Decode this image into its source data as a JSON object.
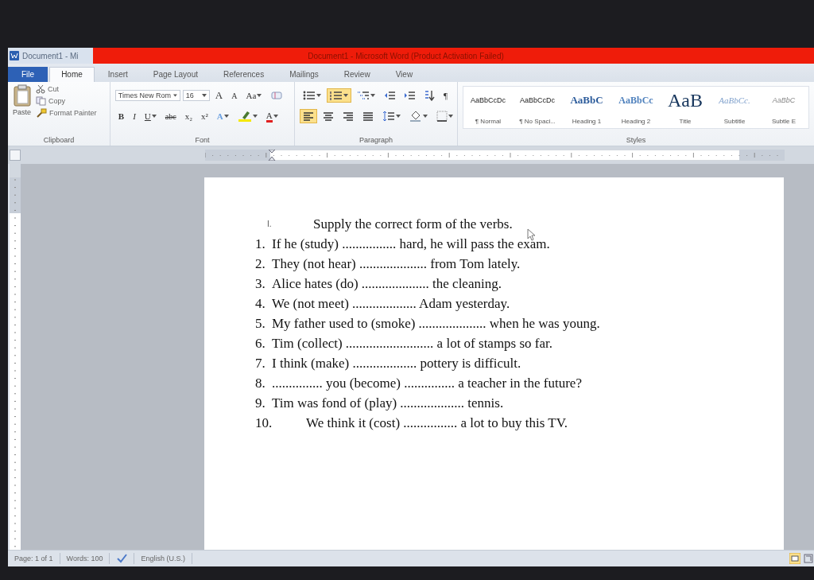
{
  "window": {
    "title_short": "Document1 - Mi",
    "title": "Document1 - Microsoft Word (Product Activation Failed)"
  },
  "tabs": [
    {
      "label": "File",
      "kind": "file",
      "selected": false
    },
    {
      "label": "Home",
      "kind": "tab",
      "selected": true
    },
    {
      "label": "Insert",
      "kind": "tab",
      "selected": false
    },
    {
      "label": "Page Layout",
      "kind": "tab",
      "selected": false
    },
    {
      "label": "References",
      "kind": "tab",
      "selected": false
    },
    {
      "label": "Mailings",
      "kind": "tab",
      "selected": false
    },
    {
      "label": "Review",
      "kind": "tab",
      "selected": false
    },
    {
      "label": "View",
      "kind": "tab",
      "selected": false
    }
  ],
  "ribbon": {
    "clipboard": {
      "label": "Clipboard",
      "paste": "Paste",
      "items": [
        {
          "kind": "cut",
          "label": "Cut"
        },
        {
          "kind": "copy",
          "label": "Copy"
        },
        {
          "kind": "painter",
          "label": "Format Painter"
        }
      ]
    },
    "font": {
      "label": "Font",
      "name": "Times New Rom",
      "size": "16",
      "row1": [
        {
          "kind": "grow",
          "label": "A"
        },
        {
          "kind": "shrink",
          "label": "A"
        },
        {
          "kind": "case",
          "label": "Aa"
        },
        {
          "kind": "clear"
        }
      ],
      "row2": [
        {
          "kind": "bold",
          "label": "B"
        },
        {
          "kind": "italic",
          "label": "I"
        },
        {
          "kind": "underline",
          "label": "U"
        },
        {
          "kind": "strike",
          "label": "abc"
        },
        {
          "kind": "sub",
          "label": "x₂"
        },
        {
          "kind": "sup",
          "label": "x²"
        },
        {
          "kind": "effects",
          "label": "A"
        },
        {
          "kind": "highlight"
        },
        {
          "kind": "color",
          "label": "A"
        }
      ]
    },
    "paragraph": {
      "label": "Paragraph",
      "row1": [
        {
          "kind": "bullets",
          "selected": false
        },
        {
          "kind": "numbering",
          "selected": true
        },
        {
          "kind": "multilevel",
          "selected": false
        },
        {
          "kind": "outdent",
          "selected": false
        },
        {
          "kind": "indent",
          "selected": false
        },
        {
          "kind": "sort",
          "selected": false
        },
        {
          "kind": "pilcrow",
          "label": "¶",
          "selected": false
        }
      ],
      "row2": [
        {
          "kind": "align-left",
          "selected": true
        },
        {
          "kind": "align-center",
          "selected": false
        },
        {
          "kind": "align-right",
          "selected": false
        },
        {
          "kind": "justify",
          "selected": false
        },
        {
          "kind": "spacing",
          "selected": false
        },
        {
          "kind": "shading",
          "selected": false
        },
        {
          "kind": "borders",
          "selected": false
        }
      ]
    },
    "styles": {
      "label": "Styles",
      "items": [
        {
          "kind": "normal",
          "preview": "AaBbCcDc",
          "label": "¶ Normal"
        },
        {
          "kind": "normal",
          "preview": "AaBbCcDc",
          "label": "¶ No Spaci..."
        },
        {
          "kind": "heading1",
          "preview": "AaBbC",
          "label": "Heading 1"
        },
        {
          "kind": "heading2",
          "preview": "AaBbCc",
          "label": "Heading 2"
        },
        {
          "kind": "title",
          "preview": "AaB",
          "label": "Title"
        },
        {
          "kind": "subtitle",
          "preview": "AaBbCc.",
          "label": "Subtitle"
        },
        {
          "kind": "subtle",
          "preview": "AaBbC",
          "label": "Subtle E"
        }
      ]
    }
  },
  "document": {
    "heading": {
      "number": "I.",
      "text": "Supply the correct form of the verbs.",
      "tabbed": true
    },
    "items": [
      {
        "number": "1.",
        "text": "If he (study) ................ hard, he will pass the exam.",
        "tabbed": false
      },
      {
        "number": "2.",
        "text": "They (not hear) .................... from Tom lately.",
        "tabbed": false
      },
      {
        "number": "3.",
        "text": "Alice hates (do) .................... the cleaning.",
        "tabbed": false
      },
      {
        "number": "4.",
        "text": "We (not meet) ................... Adam yesterday.",
        "tabbed": false
      },
      {
        "number": "5.",
        "text": "My father used to (smoke) .................... when he was young.",
        "tabbed": false
      },
      {
        "number": "6.",
        "text": "Tim (collect) .......................... a lot of stamps so far.",
        "tabbed": false
      },
      {
        "number": "7.",
        "text": "I think (make) ................... pottery is difficult.",
        "tabbed": false
      },
      {
        "number": "8.",
        "text": "............... you (become) ............... a teacher in the future?",
        "tabbed": false
      },
      {
        "number": "9.",
        "text": "Tim was fond of (play) ................... tennis.",
        "tabbed": false
      },
      {
        "number": "10.",
        "text": "We think it (cost) ................ a lot to buy this TV.",
        "tabbed": true
      }
    ]
  },
  "status_bar": {
    "page": "Page: 1 of 1",
    "words": "Words: 100",
    "language": "English (U.S.)"
  }
}
